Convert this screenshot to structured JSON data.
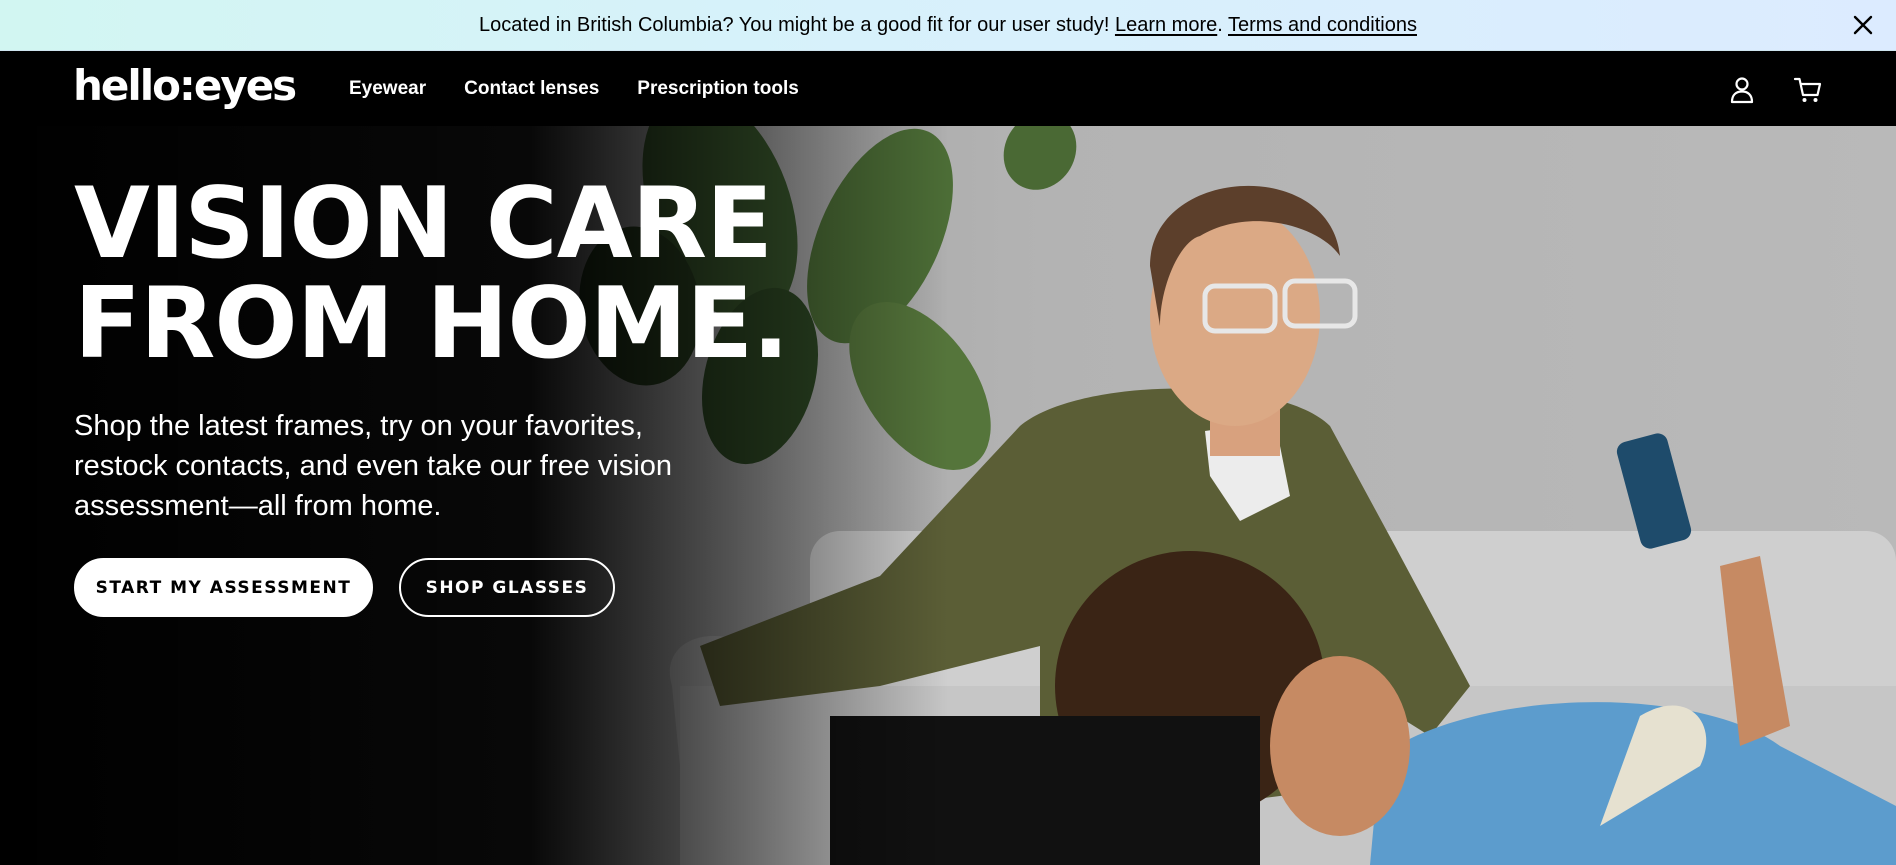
{
  "announcement": {
    "message": "Located in British Columbia? You might be a good fit for our user study!",
    "learn_more": "Learn more",
    "separator": ".",
    "terms": "Terms and conditions",
    "close_icon": "close-icon"
  },
  "header": {
    "logo": "hello:eyes",
    "nav": [
      "Eyewear",
      "Contact lenses",
      "Prescription tools"
    ],
    "icons": [
      "account-icon",
      "cart-icon"
    ]
  },
  "hero": {
    "headline_line1": "VISION CARE",
    "headline_line2": "FROM HOME.",
    "subtext": "Shop the latest frames, try on your favorites, restock contacts, and even take our free vision assessment—all from home.",
    "primary_cta": "START MY ASSESSMENT",
    "secondary_cta": "SHOP GLASSES"
  },
  "colors": {
    "announcement_bg": "#d7f1fb",
    "header_bg": "#000000",
    "hero_text": "#ffffff",
    "primary_button_bg": "#ffffff",
    "shirt": "#5b5e36",
    "sweater": "#5c9ccd"
  }
}
